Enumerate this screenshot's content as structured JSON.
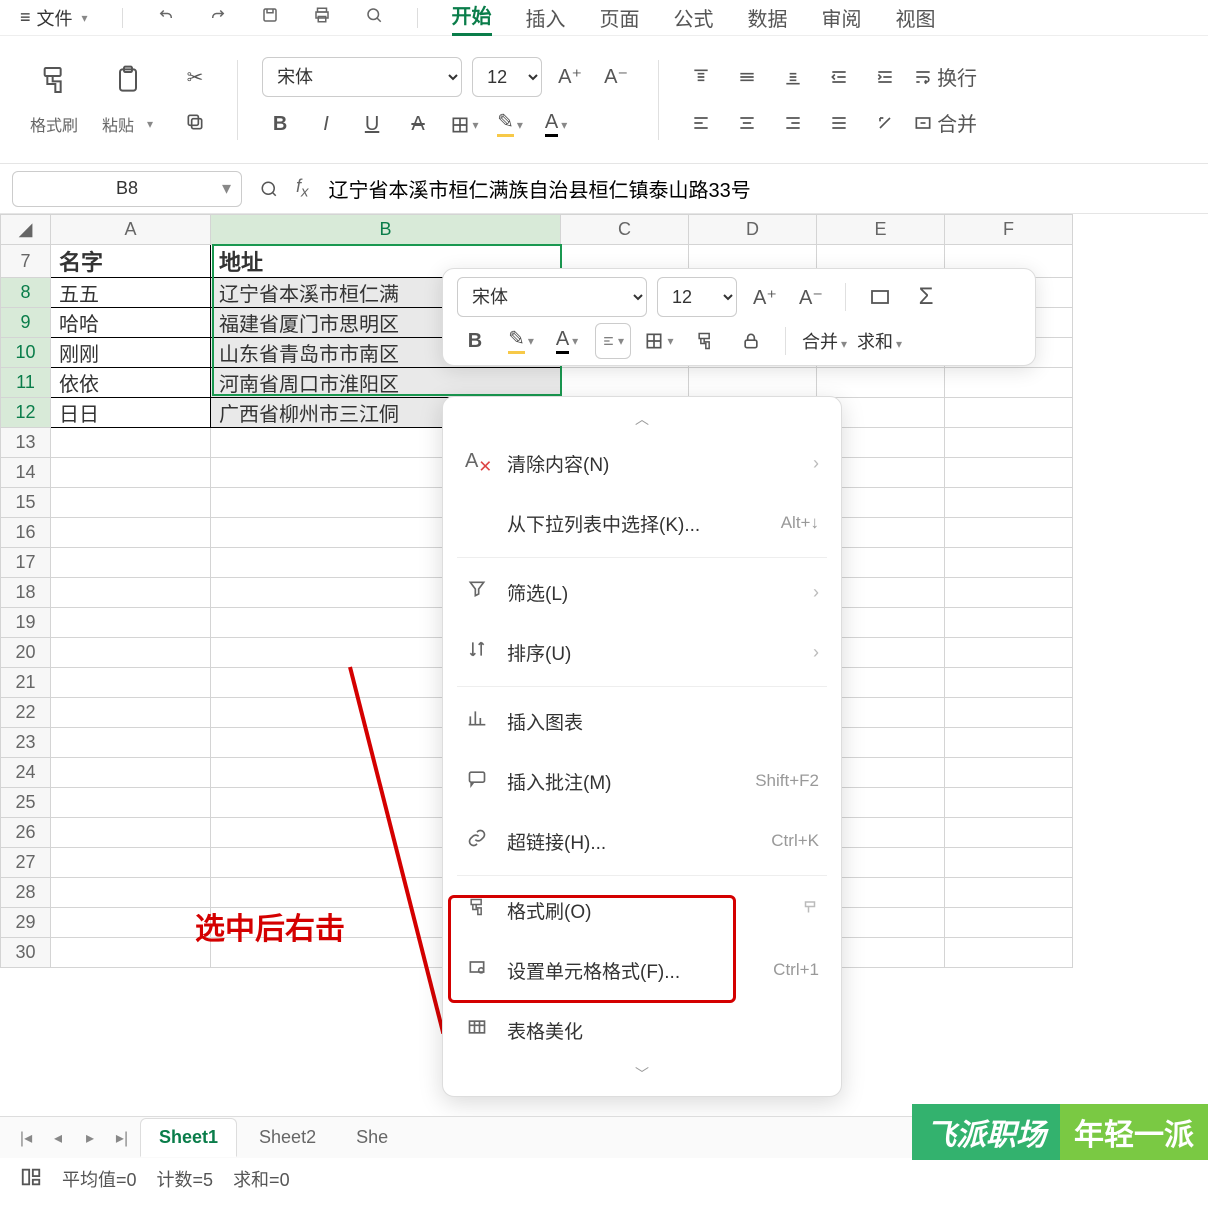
{
  "menubar": {
    "file": "文件",
    "items": [
      "开始",
      "插入",
      "页面",
      "公式",
      "数据",
      "审阅",
      "视图"
    ],
    "active_index": 0
  },
  "ribbon": {
    "format_painter": "格式刷",
    "paste": "粘贴",
    "font_name": "宋体",
    "font_size": "12",
    "wrap": "换行",
    "merge": "合并"
  },
  "namebox": "B8",
  "formula": "辽宁省本溪市桓仁满族自治县桓仁镇泰山路33号",
  "columns": [
    "A",
    "B",
    "C",
    "D",
    "E",
    "F"
  ],
  "header_row": "7",
  "headers": {
    "A": "名字",
    "B": "地址"
  },
  "rows": [
    {
      "n": "8",
      "A": "五五",
      "B": "辽宁省本溪市桓仁满"
    },
    {
      "n": "9",
      "A": "哈哈",
      "B": "福建省厦门市思明区"
    },
    {
      "n": "10",
      "A": "刚刚",
      "B": "山东省青岛市市南区"
    },
    {
      "n": "11",
      "A": "依依",
      "B": "河南省周口市淮阳区"
    },
    {
      "n": "12",
      "A": "日日",
      "B": "广西省柳州市三江侗"
    }
  ],
  "empty_rows": [
    "13",
    "14",
    "15",
    "16",
    "17",
    "18",
    "19",
    "20",
    "21",
    "22",
    "23",
    "24",
    "25",
    "26",
    "27",
    "28",
    "29",
    "30"
  ],
  "annotation": "选中后右击",
  "mini_toolbar": {
    "font_name": "宋体",
    "font_size": "12",
    "merge": "合并",
    "sum": "求和"
  },
  "context_menu": {
    "clear": "清除内容(N)",
    "dropdown_select": "从下拉列表中选择(K)...",
    "dropdown_shortcut": "Alt+↓",
    "filter": "筛选(L)",
    "sort": "排序(U)",
    "insert_chart": "插入图表",
    "insert_comment": "插入批注(M)",
    "comment_shortcut": "Shift+F2",
    "hyperlink": "超链接(H)...",
    "hyperlink_shortcut": "Ctrl+K",
    "format_painter": "格式刷(O)",
    "cell_format": "设置单元格格式(F)...",
    "cell_format_shortcut": "Ctrl+1",
    "beautify": "表格美化"
  },
  "tabs": [
    "Sheet1",
    "Sheet2",
    "She"
  ],
  "active_tab": 0,
  "statusbar": {
    "avg": "平均值=0",
    "count": "计数=5",
    "sum": "求和=0"
  },
  "watermark": {
    "a": "飞派职场",
    "b": "年轻一派"
  }
}
